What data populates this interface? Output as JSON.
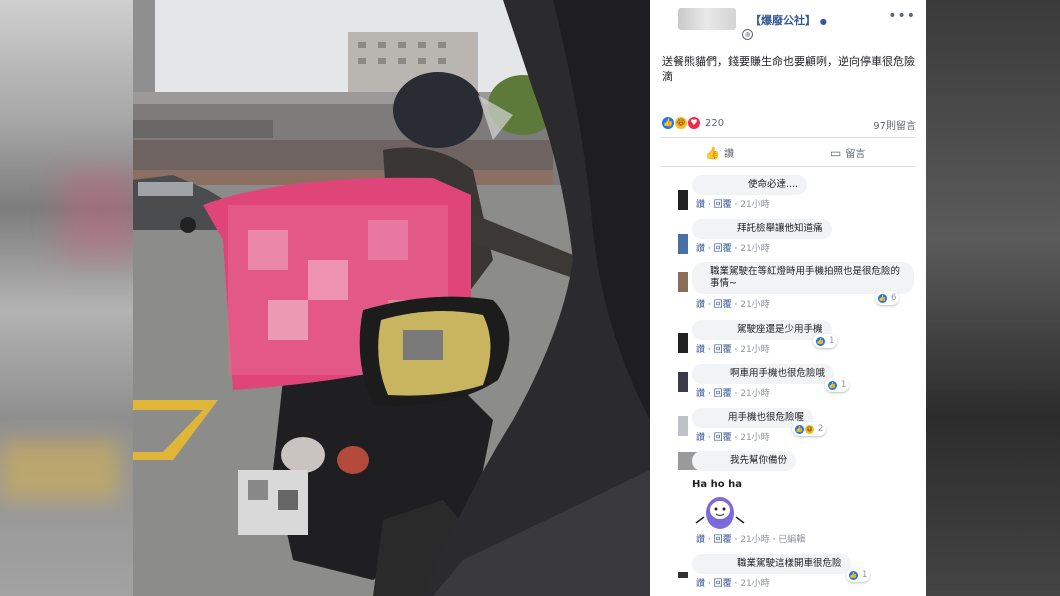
{
  "post": {
    "page_name": "【爆廢公社】",
    "text": "送餐熊貓們，錢要賺生命也要顧咧，逆向停車很危險滴",
    "reaction_count": "220",
    "comment_count": "97則留言",
    "like_label": "讚",
    "comment_label": "留言"
  },
  "comments": [
    {
      "text": "使命必達....",
      "like": "讚",
      "reply": "回覆",
      "time": "21小時",
      "reactions": ""
    },
    {
      "text": "拜託檢舉讓他知道痛",
      "like": "讚",
      "reply": "回覆",
      "time": "21小時",
      "reactions": ""
    },
    {
      "text": "職業駕駛在等紅燈時用手機拍照也是很危險的事情~",
      "like": "讚",
      "reply": "回覆",
      "time": "21小時",
      "reactions": "6"
    },
    {
      "text": "駕駛座還是少用手機",
      "like": "讚",
      "reply": "回覆",
      "time": "21小時",
      "reactions": "1"
    },
    {
      "text": "啊車用手機也很危險哦",
      "like": "讚",
      "reply": "回覆",
      "time": "21小時",
      "reactions": "1"
    },
    {
      "text": "用手機也很危險喔",
      "like": "讚",
      "reply": "回覆",
      "time": "21小時",
      "reactions": "2"
    },
    {
      "text": "我先幫你備份",
      "like": "讚",
      "reply": "回覆",
      "time": "21小時",
      "edited": "已編輯",
      "reactions": ""
    },
    {
      "text": "職業駕駛這樣開車很危險",
      "like": "讚",
      "reply": "回覆",
      "time": "21小時",
      "reactions": "1"
    }
  ],
  "sticker_text": "Ha ho ha",
  "icons": {
    "more": "more-options-icon",
    "globe": "globe-icon",
    "like": "thumbs-up-icon",
    "comment": "comment-icon"
  },
  "colors": {
    "link": "#385898",
    "like_blue": "#1877f2",
    "bubble": "#f2f3f5"
  }
}
